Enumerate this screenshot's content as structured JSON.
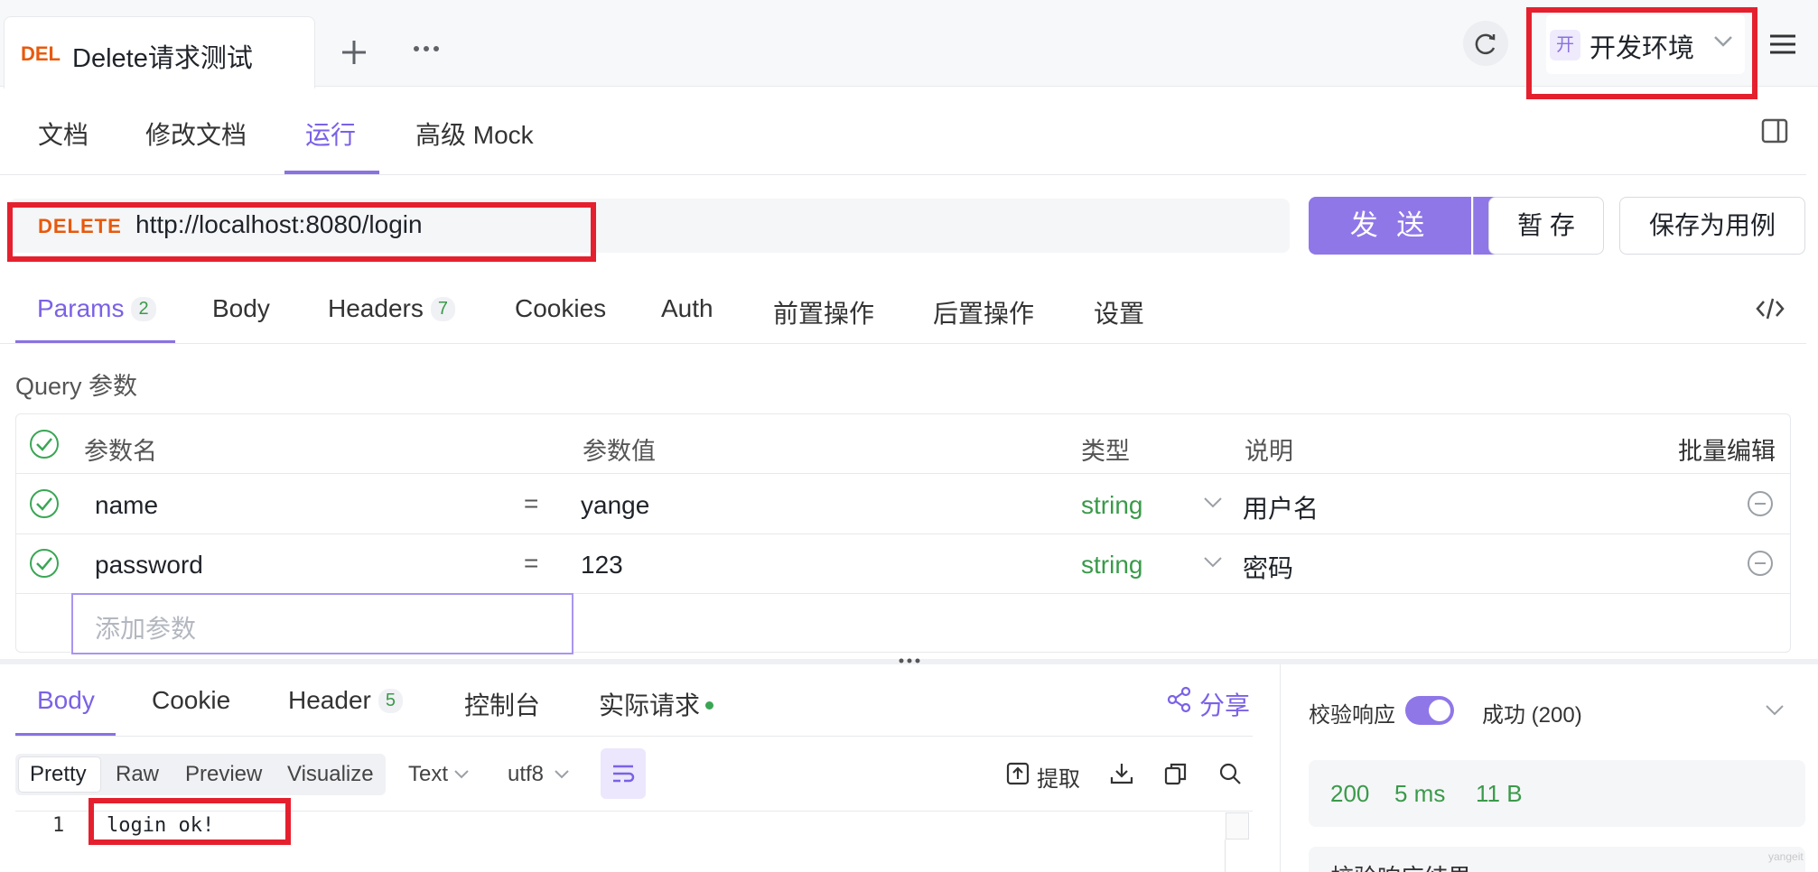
{
  "tab": {
    "method": "DEL",
    "title": "Delete请求测试"
  },
  "env": {
    "badge": "开",
    "name": "开发环境"
  },
  "doc_tabs": [
    "文档",
    "修改文档",
    "运行",
    "高级 Mock"
  ],
  "request": {
    "method": "DELETE",
    "url": "http://localhost:8080/login",
    "send_label": "发 送",
    "save_label": "暂 存",
    "save_case_label": "保存为用例"
  },
  "param_tabs": [
    {
      "label": "Params",
      "badge": "2"
    },
    {
      "label": "Body",
      "badge": ""
    },
    {
      "label": "Headers",
      "badge": "7"
    },
    {
      "label": "Cookies",
      "badge": ""
    },
    {
      "label": "Auth",
      "badge": ""
    },
    {
      "label": "前置操作",
      "badge": ""
    },
    {
      "label": "后置操作",
      "badge": ""
    },
    {
      "label": "设置",
      "badge": ""
    }
  ],
  "query_label": "Query 参数",
  "table": {
    "headers": {
      "name": "参数名",
      "value": "参数值",
      "type": "类型",
      "desc": "说明",
      "bulk": "批量编辑"
    },
    "rows": [
      {
        "name": "name",
        "eq": "=",
        "value": "yange",
        "type": "string",
        "desc": "用户名"
      },
      {
        "name": "password",
        "eq": "=",
        "value": "123",
        "type": "string",
        "desc": "密码"
      }
    ],
    "add_placeholder": "添加参数"
  },
  "response_tabs": [
    {
      "label": "Body",
      "badge": ""
    },
    {
      "label": "Cookie",
      "badge": ""
    },
    {
      "label": "Header",
      "badge": "5"
    },
    {
      "label": "控制台",
      "badge": ""
    },
    {
      "label": "实际请求",
      "badge": ""
    }
  ],
  "share_label": "分享",
  "view_modes": [
    "Pretty",
    "Raw",
    "Preview",
    "Visualize"
  ],
  "format": {
    "type": "Text",
    "encoding": "utf8"
  },
  "extract_label": "提取",
  "code": {
    "line": "1",
    "text": "login ok!"
  },
  "validate": {
    "label": "校验响应",
    "result": "成功 (200)"
  },
  "stats": {
    "status": "200",
    "time": "5 ms",
    "size": "11 B"
  },
  "bottom_cut": "校验响应结果",
  "watermark": "yangeit"
}
